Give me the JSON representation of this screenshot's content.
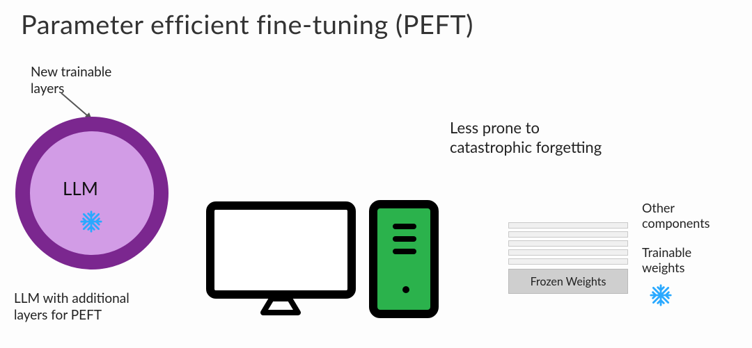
{
  "title": "Parameter efficient fine-tuning (PEFT)",
  "labels": {
    "new_layers": "New trainable\nlayers",
    "llm": "LLM",
    "caption": "LLM with additional\nlayers for PEFT",
    "forgetting": "Less prone to\ncatastrophic forgetting",
    "other": "Other\ncomponents",
    "trainable": "Trainable\nweights",
    "frozen": "Frozen Weights"
  },
  "colors": {
    "ring": "#7b278f",
    "disc": "#d29ce6",
    "tower": "#2bb24c",
    "snow": "#2aa9ff",
    "frozen_bg": "#cfcfcf"
  },
  "icons": {
    "circle": "llm-circle",
    "snow": "snowflake-icon",
    "monitor": "monitor-icon",
    "tower": "pc-tower-icon",
    "arrow": "pointer-arrow"
  }
}
